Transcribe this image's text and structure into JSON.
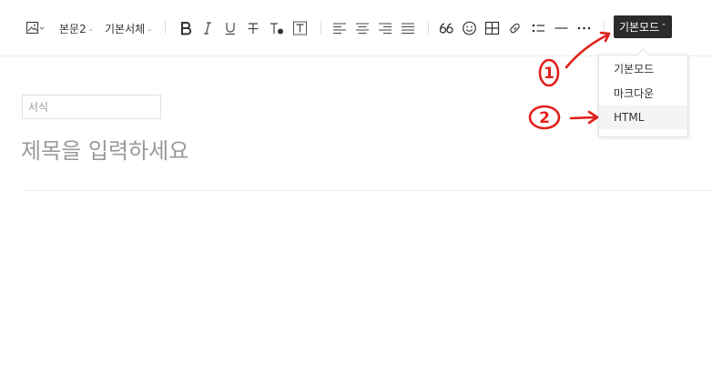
{
  "toolbar": {
    "paragraph_style": "본문2",
    "font_family": "기본서체",
    "mode_button_label": "기본모드"
  },
  "mode_menu": {
    "items": [
      {
        "label": "기본모드"
      },
      {
        "label": "마크다운"
      },
      {
        "label": "HTML"
      }
    ]
  },
  "editor": {
    "format_placeholder": "서식",
    "title_placeholder": "제목을 입력하세요"
  },
  "annotations": {
    "step1": "1",
    "step2": "2",
    "color": "#e0201b"
  },
  "icons": [
    "image-icon",
    "bold-icon",
    "italic-icon",
    "underline-icon",
    "strikethrough-icon",
    "text-color-icon",
    "text-background-icon",
    "align-left-icon",
    "align-center-icon",
    "align-right-icon",
    "align-justify-icon",
    "quote-icon",
    "emoji-icon",
    "table-icon",
    "link-icon",
    "list-icon",
    "horizontal-rule-icon",
    "more-icon"
  ]
}
